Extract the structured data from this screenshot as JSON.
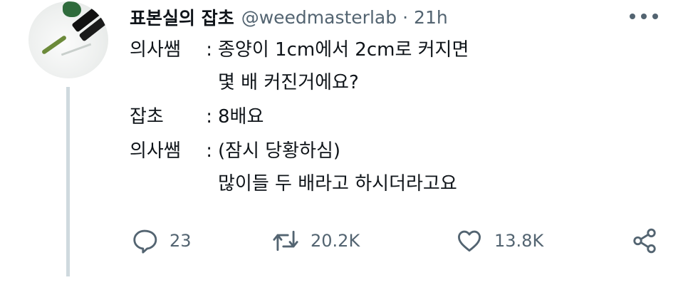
{
  "tweet": {
    "display_name": "표본실의 잡초",
    "handle": "@weedmasterlab",
    "separator": "·",
    "time": "21h",
    "more_icon": "ellipsis-icon",
    "avatar_icon": "avatar-photo",
    "lines": [
      {
        "speaker": "의사쌤",
        "colon": ":",
        "text": [
          "종양이 1cm에서 2cm로 커지면",
          "몇 배 커진거에요?"
        ]
      },
      {
        "speaker": "잡초",
        "colon": ":",
        "text": [
          "8배요"
        ]
      },
      {
        "speaker": "의사쌤",
        "colon": ":",
        "text": [
          "(잠시 당황하심)",
          "많이들 두 배라고 하시더라고요"
        ]
      }
    ]
  },
  "actions": {
    "reply": {
      "icon": "reply-icon",
      "count": "23"
    },
    "retweet": {
      "icon": "retweet-icon",
      "count": "20.2K"
    },
    "like": {
      "icon": "heart-icon",
      "count": "13.8K"
    },
    "share": {
      "icon": "share-icon"
    }
  },
  "colors": {
    "text": "#0f1419",
    "secondary": "#536471",
    "thread_line": "#cfd9de"
  }
}
